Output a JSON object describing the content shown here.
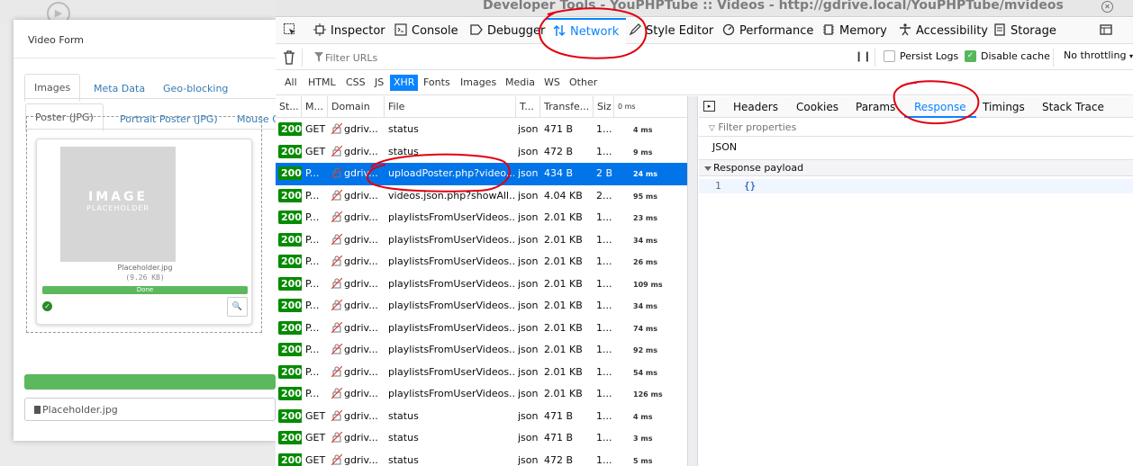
{
  "background_page": {
    "modal": {
      "title": "Video Form",
      "tabs": [
        "Images",
        "Meta Data",
        "Geo-blocking"
      ],
      "subtabs": [
        "Poster (JPG)",
        "Portrait Poster (JPG)",
        "Mouse O"
      ],
      "placeholder_line1": "IMAGE",
      "placeholder_line2": "PLACEHOLDER",
      "file_name": "Placeholder.jpg",
      "file_size": "(9.26 KB)",
      "progress_label": "Done",
      "progress_fraction": 1.0,
      "file_input_value": "Placeholder.jpg"
    }
  },
  "devtools": {
    "window_title": "Developer Tools - YouPHPTube :: Videos - http://gdrive.local/YouPHPTube/mvideos",
    "tabs": [
      "Inspector",
      "Console",
      "Debugger",
      "Network",
      "Style Editor",
      "Performance",
      "Memory",
      "Accessibility",
      "Storage"
    ],
    "active_tab": "Network",
    "filter_placeholder": "Filter URLs",
    "persist_logs": "Persist Logs",
    "disable_cache": "Disable cache",
    "disable_cache_checked": true,
    "throttling": "No throttling",
    "type_filters": [
      "All",
      "HTML",
      "CSS",
      "JS",
      "XHR",
      "Fonts",
      "Images",
      "Media",
      "WS",
      "Other"
    ],
    "active_type": "XHR",
    "columns": [
      "St...",
      "M...",
      "Domain",
      "File",
      "T...",
      "Transfe...",
      "Siz",
      "0 ms"
    ],
    "requests": [
      {
        "status": "200",
        "method": "GET",
        "domain": "gdriv...",
        "file": "status",
        "type": "json",
        "transferred": "471 B",
        "size": "1...",
        "time": "4 ms"
      },
      {
        "status": "200",
        "method": "GET",
        "domain": "gdriv...",
        "file": "status",
        "type": "json",
        "transferred": "472 B",
        "size": "1...",
        "time": "9 ms"
      },
      {
        "status": "200",
        "method": "P...",
        "domain": "gdriv...",
        "file": "uploadPoster.php?video...",
        "type": "json",
        "transferred": "434 B",
        "size": "2 B",
        "time": "24 ms",
        "selected": true
      },
      {
        "status": "200",
        "method": "P...",
        "domain": "gdriv...",
        "file": "videos.json.php?showAll...",
        "type": "json",
        "transferred": "4.04 KB",
        "size": "2...",
        "time": "95 ms"
      },
      {
        "status": "200",
        "method": "P...",
        "domain": "gdriv...",
        "file": "playlistsFromUserVideos...",
        "type": "json",
        "transferred": "2.01 KB",
        "size": "1...",
        "time": "23 ms"
      },
      {
        "status": "200",
        "method": "P...",
        "domain": "gdriv...",
        "file": "playlistsFromUserVideos...",
        "type": "json",
        "transferred": "2.01 KB",
        "size": "1...",
        "time": "34 ms"
      },
      {
        "status": "200",
        "method": "P...",
        "domain": "gdriv...",
        "file": "playlistsFromUserVideos...",
        "type": "json",
        "transferred": "2.01 KB",
        "size": "1...",
        "time": "26 ms"
      },
      {
        "status": "200",
        "method": "P...",
        "domain": "gdriv...",
        "file": "playlistsFromUserVideos...",
        "type": "json",
        "transferred": "2.01 KB",
        "size": "1...",
        "time": "109 ms"
      },
      {
        "status": "200",
        "method": "P...",
        "domain": "gdriv...",
        "file": "playlistsFromUserVideos...",
        "type": "json",
        "transferred": "2.01 KB",
        "size": "1...",
        "time": "34 ms"
      },
      {
        "status": "200",
        "method": "P...",
        "domain": "gdriv...",
        "file": "playlistsFromUserVideos...",
        "type": "json",
        "transferred": "2.01 KB",
        "size": "1...",
        "time": "74 ms"
      },
      {
        "status": "200",
        "method": "P...",
        "domain": "gdriv...",
        "file": "playlistsFromUserVideos...",
        "type": "json",
        "transferred": "2.01 KB",
        "size": "1...",
        "time": "92 ms"
      },
      {
        "status": "200",
        "method": "P...",
        "domain": "gdriv...",
        "file": "playlistsFromUserVideos...",
        "type": "json",
        "transferred": "2.01 KB",
        "size": "1...",
        "time": "54 ms"
      },
      {
        "status": "200",
        "method": "P...",
        "domain": "gdriv...",
        "file": "playlistsFromUserVideos...",
        "type": "json",
        "transferred": "2.01 KB",
        "size": "1...",
        "time": "126 ms"
      },
      {
        "status": "200",
        "method": "GET",
        "domain": "gdriv...",
        "file": "status",
        "type": "json",
        "transferred": "471 B",
        "size": "1...",
        "time": "4 ms"
      },
      {
        "status": "200",
        "method": "GET",
        "domain": "gdriv...",
        "file": "status",
        "type": "json",
        "transferred": "471 B",
        "size": "1...",
        "time": "3 ms"
      },
      {
        "status": "200",
        "method": "GET",
        "domain": "gdriv...",
        "file": "status",
        "type": "json",
        "transferred": "472 B",
        "size": "1...",
        "time": "5 ms"
      }
    ],
    "side_tabs": [
      "Headers",
      "Cookies",
      "Params",
      "Response",
      "Timings",
      "Stack Trace"
    ],
    "active_side_tab": "Response",
    "filter_properties": "Filter properties",
    "json_label": "JSON",
    "payload_label": "Response payload",
    "line_number": "1",
    "payload_code": "{}"
  },
  "colors": {
    "accent": "#0a84ff",
    "annotation": "#e3000f",
    "status_ok": "#058b00",
    "selected_row": "#0074e8"
  }
}
